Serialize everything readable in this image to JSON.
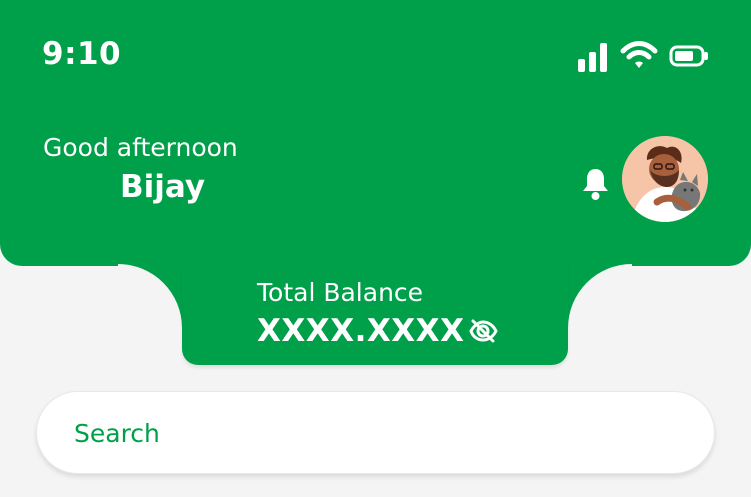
{
  "status_bar": {
    "time": "9:10",
    "icons": [
      "signal-icon",
      "wifi-icon",
      "battery-icon"
    ]
  },
  "header": {
    "greeting": "Good afternoon",
    "user_name": "Bijay",
    "notification_icon": "bell-icon",
    "avatar_icon": "user-avatar"
  },
  "balance": {
    "label": "Total Balance",
    "value": "XXXX.XXXX",
    "visibility_icon": "eye-off-icon"
  },
  "search": {
    "placeholder": "Search"
  },
  "colors": {
    "brand_green": "#00a04a",
    "background": "#f4f4f4",
    "white": "#ffffff"
  }
}
